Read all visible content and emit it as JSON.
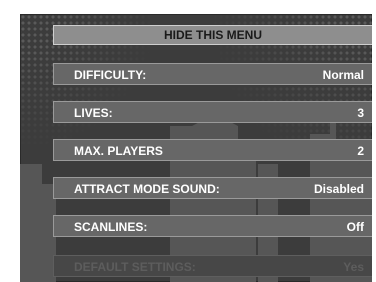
{
  "hide_menu": {
    "label": "HIDE THIS MENU"
  },
  "settings": [
    {
      "label": "DIFFICULTY:",
      "value": "Normal",
      "enabled": true
    },
    {
      "label": "LIVES:",
      "value": "3",
      "enabled": true
    },
    {
      "label": "MAX. PLAYERS",
      "value": "2",
      "enabled": true
    },
    {
      "label": "ATTRACT MODE SOUND:",
      "value": "Disabled",
      "enabled": true
    },
    {
      "label": "SCANLINES:",
      "value": "Off",
      "enabled": true
    },
    {
      "label": "DEFAULT SETTINGS:",
      "value": "Yes",
      "enabled": false
    }
  ],
  "colors": {
    "panel_background": "#3c3c3c",
    "item_background": "#676767",
    "item_border": "#9a9a9a",
    "header_button": "#8e8e8e",
    "text": "#ffffff",
    "disabled_text": "#5d5d5d",
    "skyline": "#565656"
  }
}
